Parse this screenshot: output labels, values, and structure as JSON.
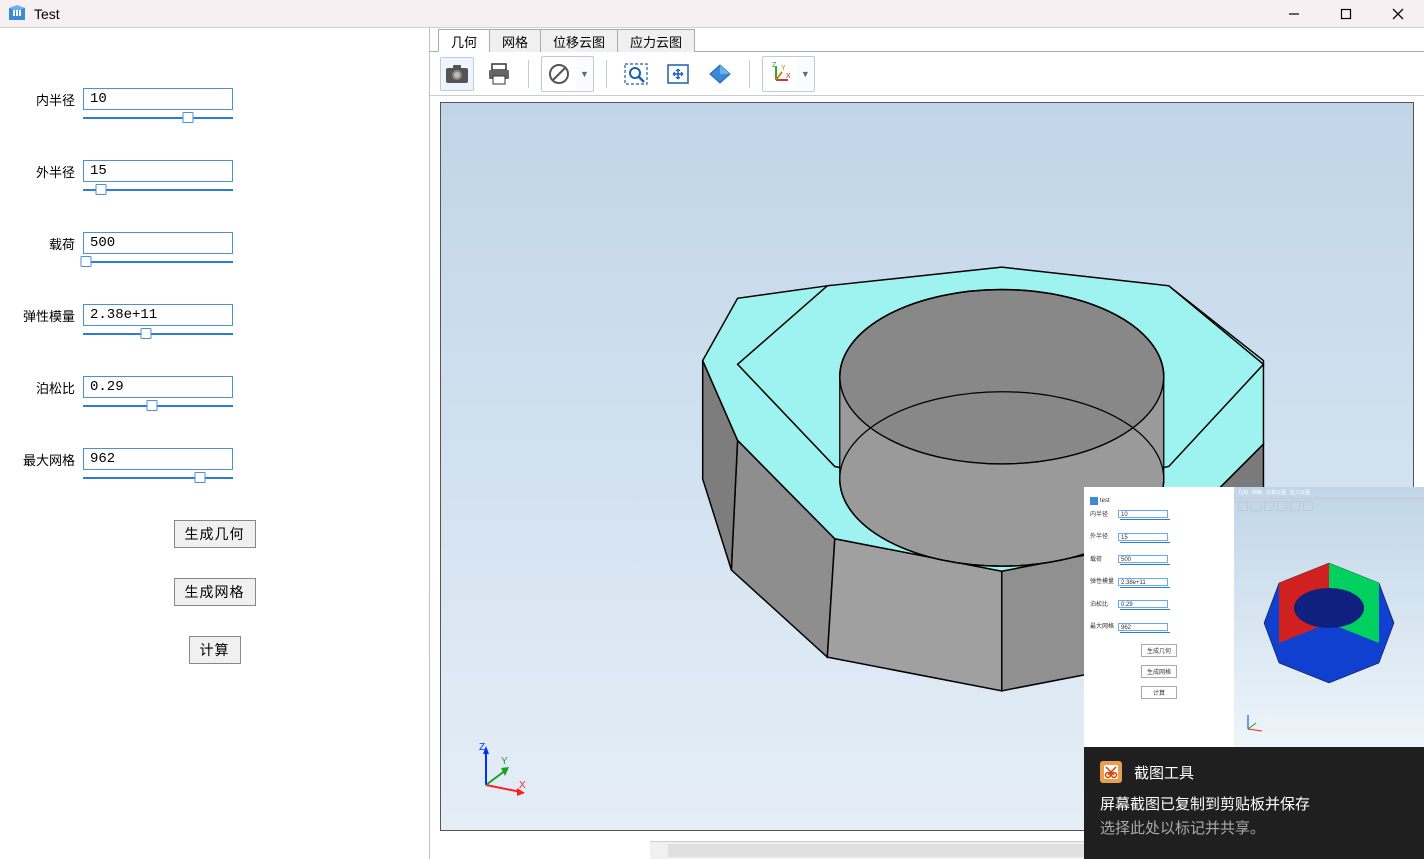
{
  "window": {
    "title": "Test"
  },
  "params": {
    "inner_radius": {
      "label": "内半径",
      "value": "10",
      "thumb_pct": 70
    },
    "outer_radius": {
      "label": "外半径",
      "value": "15",
      "thumb_pct": 12
    },
    "load": {
      "label": "载荷",
      "value": "500",
      "thumb_pct": 2
    },
    "elastic": {
      "label": "弹性模量",
      "value": "2.38e+11",
      "thumb_pct": 42
    },
    "poisson": {
      "label": "泊松比",
      "value": "0.29",
      "thumb_pct": 46
    },
    "max_mesh": {
      "label": "最大网格",
      "value": "962",
      "thumb_pct": 78
    }
  },
  "buttons": {
    "gen_geometry": "生成几何",
    "gen_mesh": "生成网格",
    "compute": "计算"
  },
  "tabs": {
    "geometry": "几何",
    "mesh": "网格",
    "disp_contour": "位移云图",
    "stress_contour": "应力云图"
  },
  "axis": {
    "x": "X",
    "y": "Y",
    "z": "Z"
  },
  "notification": {
    "app": "截图工具",
    "line1": "屏幕截图已复制到剪贴板并保存",
    "line2": "选择此处以标记并共享。",
    "thumb_title": "test"
  }
}
